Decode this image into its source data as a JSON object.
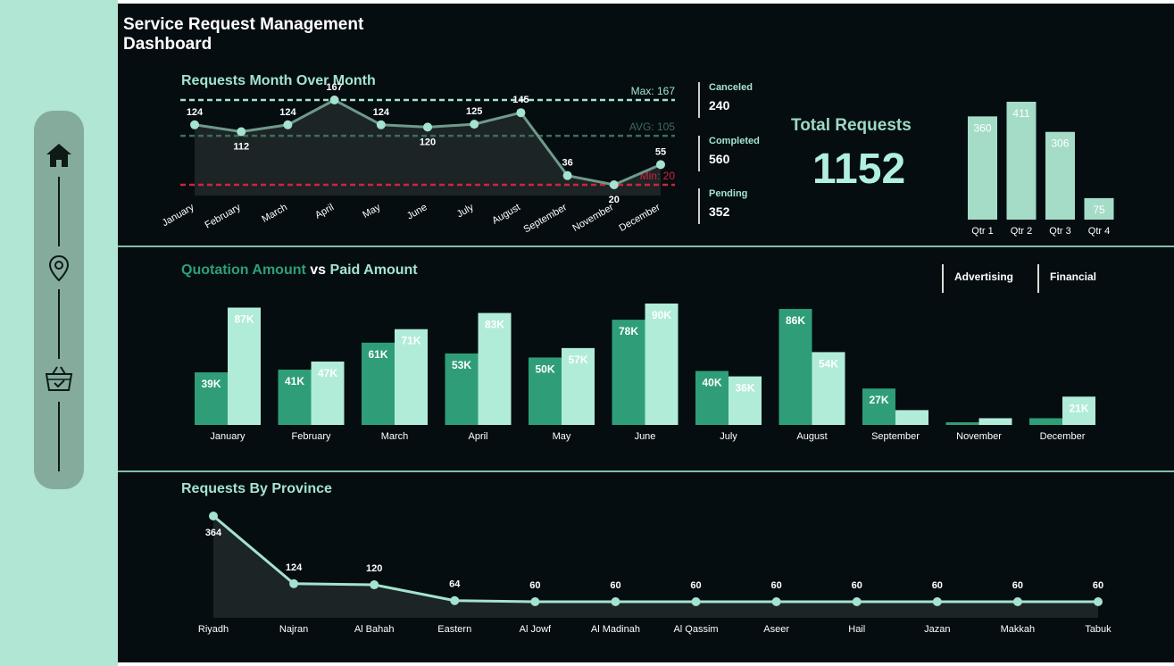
{
  "dashboard": {
    "title_line1": "Service Request Management",
    "title_line2": "Dashboard"
  },
  "sidebar": {
    "items": [
      {
        "icon": "home-icon"
      },
      {
        "icon": "location-pin-icon"
      },
      {
        "icon": "basket-icon"
      }
    ]
  },
  "colors": {
    "background": "#050d10",
    "sidebar": "#b1e5d4",
    "accent_light": "#a4e3cf",
    "accent_dark": "#2f9e78",
    "min_line": "#d2233c"
  },
  "kpis": {
    "canceled_label": "Canceled",
    "canceled_value": "240",
    "completed_label": "Completed",
    "completed_value": "560",
    "pending_label": "Pending",
    "pending_value": "352"
  },
  "total": {
    "label": "Total Requests",
    "value": "1152"
  },
  "categories": {
    "advertising": "Advertising",
    "financial": "Financial"
  },
  "quotation_title": {
    "part1": "Quotation Amount",
    "part2": " vs ",
    "part3": "Paid Amount"
  },
  "chart_data": [
    {
      "type": "line",
      "title": "Requests Month Over Month",
      "categories": [
        "January",
        "February",
        "March",
        "April",
        "May",
        "June",
        "July",
        "August",
        "September",
        "November",
        "December"
      ],
      "values": [
        124,
        112,
        124,
        167,
        124,
        120,
        125,
        145,
        36,
        20,
        55
      ],
      "reference_lines": [
        {
          "label": "Max: 167",
          "value": 167
        },
        {
          "label": "AVG: 105",
          "value": 105
        },
        {
          "label": "Min: 20",
          "value": 20
        }
      ]
    },
    {
      "type": "bar",
      "categories": [
        "Qtr 1",
        "Qtr 2",
        "Qtr 3",
        "Qtr 4"
      ],
      "values": [
        360,
        411,
        306,
        75
      ]
    },
    {
      "type": "bar",
      "title": "Quotation Amount vs Paid Amount",
      "categories": [
        "January",
        "February",
        "March",
        "April",
        "May",
        "June",
        "July",
        "August",
        "September",
        "November",
        "December"
      ],
      "series": [
        {
          "name": "Quotation Amount",
          "values": [
            39,
            41,
            61,
            53,
            50,
            78,
            40,
            86,
            27,
            2,
            5
          ],
          "labels": [
            "39K",
            "41K",
            "61K",
            "53K",
            "50K",
            "78K",
            "40K",
            "86K",
            "27K",
            "",
            ""
          ]
        },
        {
          "name": "Paid Amount",
          "values": [
            87,
            47,
            71,
            83,
            57,
            90,
            36,
            54,
            11,
            5,
            21
          ],
          "labels": [
            "87K",
            "47K",
            "71K",
            "83K",
            "57K",
            "90K",
            "36K",
            "54K",
            "",
            "",
            "21K"
          ]
        }
      ]
    },
    {
      "type": "area",
      "title": "Requests By Province",
      "categories": [
        "Riyadh",
        "Najran",
        "Al Bahah",
        "Eastern",
        "Al Jowf",
        "Al Madinah",
        "Al Qassim",
        "Aseer",
        "Hail",
        "Jazan",
        "Makkah",
        "Tabuk"
      ],
      "values": [
        364,
        124,
        120,
        64,
        60,
        60,
        60,
        60,
        60,
        60,
        60,
        60
      ]
    }
  ]
}
